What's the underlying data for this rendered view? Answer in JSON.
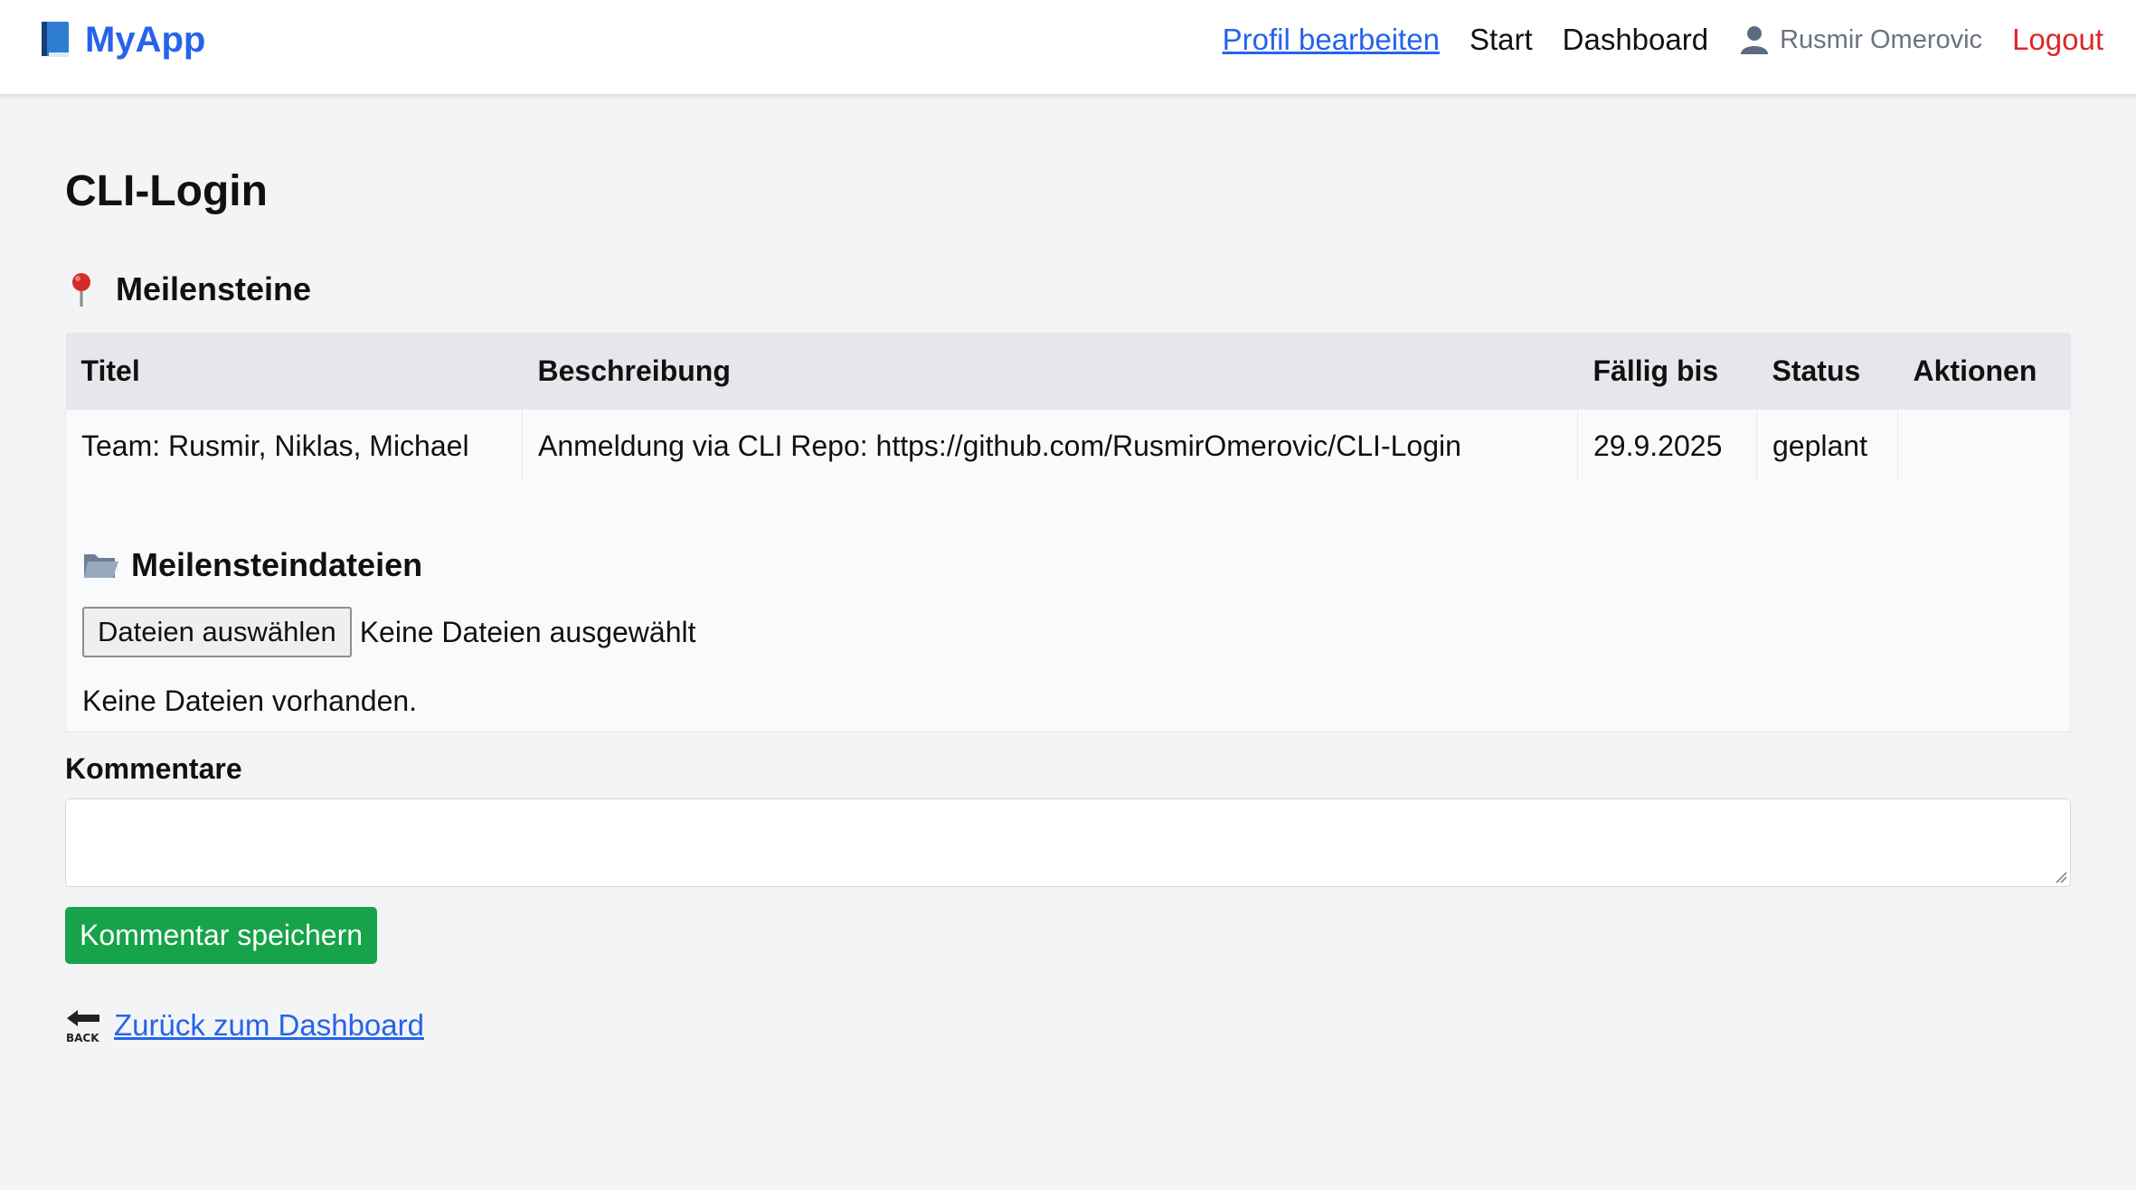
{
  "navbar": {
    "brand": "MyApp",
    "brand_icon": "book-icon",
    "links": {
      "profile": "Profil bearbeiten",
      "start": "Start",
      "dashboard": "Dashboard"
    },
    "user": {
      "name": "Rusmir Omerovic",
      "icon": "user-icon"
    },
    "logout": "Logout"
  },
  "page": {
    "title": "CLI-Login"
  },
  "milestones": {
    "heading": "Meilensteine",
    "icon": "pushpin-icon",
    "columns": [
      "Titel",
      "Beschreibung",
      "Fällig bis",
      "Status",
      "Aktionen"
    ],
    "rows": [
      {
        "titel": "Team: Rusmir, Niklas, Michael",
        "beschreibung": "Anmeldung via CLI Repo: https://github.com/RusmirOmerovic/CLI-Login",
        "faellig": "29.9.2025",
        "status": "geplant",
        "aktionen": ""
      }
    ]
  },
  "files": {
    "heading": "Meilensteindateien",
    "icon": "folder-icon",
    "choose_button": "Dateien auswählen",
    "chosen_status": "Keine Dateien ausgewählt",
    "empty_message": "Keine Dateien vorhanden."
  },
  "comments": {
    "label": "Kommentare",
    "value": "",
    "save_button": "Kommentar speichern"
  },
  "back": {
    "label": "Zurück zum Dashboard",
    "icon": "back-arrow-icon"
  },
  "colors": {
    "accent": "#2563eb",
    "logout": "#dc2626",
    "success": "#16a34a",
    "background": "#f3f4f6",
    "table_header": "#e5e7eb"
  }
}
